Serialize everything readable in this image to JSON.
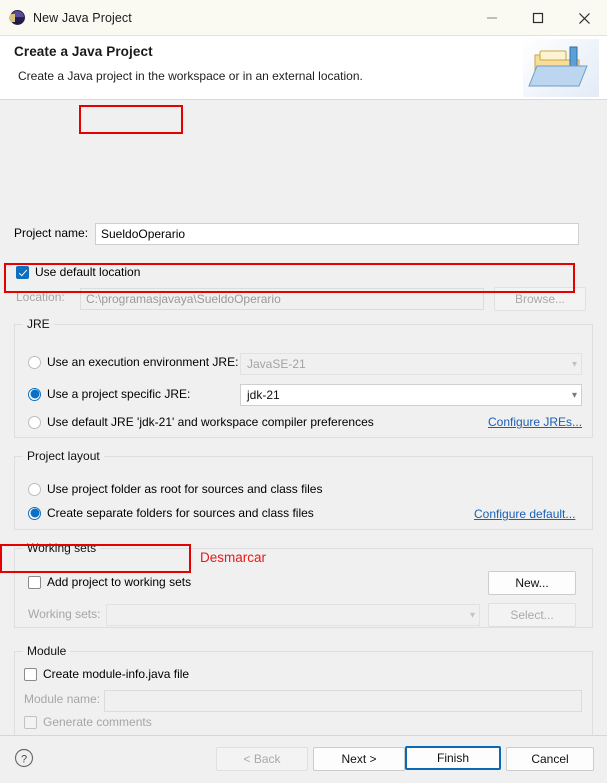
{
  "window": {
    "title": "New Java Project",
    "icon": "eclipse-icon",
    "minimize": "minimize-icon",
    "maximize": "maximize-icon",
    "close": "close-icon"
  },
  "header": {
    "title": "Create a Java Project",
    "subtitle": "Create a Java project in the workspace or in an external location.",
    "banner_icon": "java-project-folder-icon"
  },
  "project": {
    "name_label": "Project name:",
    "name_value": "SueldoOperario",
    "use_default_location_label": "Use default location",
    "use_default_location_checked": true,
    "location_label": "Location:",
    "location_value": "C:\\programasjavaya\\SueldoOperario",
    "browse_label": "Browse..."
  },
  "jre": {
    "group_title": "JRE",
    "option_execution_env_label": "Use an execution environment JRE:",
    "option_execution_env_selected": false,
    "execution_env_value": "JavaSE-21",
    "option_project_specific_label": "Use a project specific JRE:",
    "option_project_specific_selected": true,
    "project_specific_value": "jdk-21",
    "option_default_jre_label": "Use default JRE 'jdk-21' and workspace compiler preferences",
    "option_default_jre_selected": false,
    "configure_link": "Configure JREs..."
  },
  "layout": {
    "group_title": "Project layout",
    "option_root_label": "Use project folder as root for sources and class files",
    "option_root_selected": false,
    "option_separate_label": "Create separate folders for sources and class files",
    "option_separate_selected": true,
    "configure_link": "Configure default..."
  },
  "working_sets": {
    "group_title": "Working sets",
    "add_label": "Add project to working sets",
    "add_checked": false,
    "sets_label": "Working sets:",
    "sets_value": "",
    "new_label": "New...",
    "select_label": "Select..."
  },
  "module": {
    "group_title": "Module",
    "create_module_info_label": "Create module-info.java file",
    "create_module_info_checked": false,
    "module_name_label": "Module name:",
    "module_name_value": "",
    "generate_comments_label": "Generate comments",
    "generate_comments_checked": false
  },
  "annotations": {
    "uncheck_note": "Desmarcar",
    "highlight_color": "#e60000",
    "note_color": "#e8191b"
  },
  "footer": {
    "help_icon": "help-icon",
    "back_label": "< Back",
    "back_disabled": true,
    "next_label": "Next >",
    "finish_label": "Finish",
    "finish_is_default": true,
    "cancel_label": "Cancel"
  }
}
